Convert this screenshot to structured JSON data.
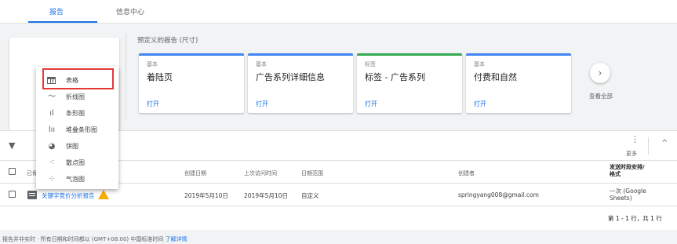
{
  "tabs": [
    {
      "label": "报告"
    },
    {
      "label": "信息中心"
    }
  ],
  "predefined": {
    "label": "预定义的报告 (尺寸)",
    "cards": [
      {
        "category": "基本",
        "name": "着陆页",
        "open": "打开"
      },
      {
        "category": "基本",
        "name": "广告系列详细信息",
        "open": "打开"
      },
      {
        "category": "标签",
        "name": "标签 - 广告系列",
        "open": "打开"
      },
      {
        "category": "基本",
        "name": "付费和自然",
        "open": "打开"
      }
    ],
    "see_all": "查看全部"
  },
  "menu": {
    "items": [
      {
        "label": "表格",
        "icon": "table-icon"
      },
      {
        "label": "折线图",
        "icon": "line-chart-icon"
      },
      {
        "label": "条形图",
        "icon": "bar-chart-icon"
      },
      {
        "label": "堆叠条形图",
        "icon": "stacked-bar-chart-icon"
      },
      {
        "label": "饼图",
        "icon": "pie-chart-icon"
      },
      {
        "label": "散点图",
        "icon": "scatter-chart-icon"
      },
      {
        "label": "气泡图",
        "icon": "bubble-chart-icon"
      }
    ]
  },
  "toolbar": {
    "more_label": "更多"
  },
  "table": {
    "headers": {
      "name": "已保",
      "created": "创建日期",
      "last_access": "上次访问时间",
      "date_range": "日期范围",
      "creator": "创建者",
      "schedule": "发送时段安排/\n格式"
    },
    "rows": [
      {
        "name": "关键字竞价分析报告",
        "created": "2019年5月10日",
        "last_access": "2019年5月10日",
        "date_range": "自定义",
        "creator": "springyang008@gmail.com",
        "schedule": "一次 (Google\nSheets)"
      }
    ]
  },
  "pager": "第 1 - 1 行，共 1 行",
  "footer": {
    "text": "报告并非实时 · 所有日期和时间都以 (GMT+08:00) 中国标准时间",
    "link": "了解详情"
  },
  "colors": {
    "accent": "#1a73e8",
    "highlight": "#e53935",
    "warning": "#f9ab00",
    "card_blue": "#4285f4",
    "card_green": "#34a853"
  }
}
